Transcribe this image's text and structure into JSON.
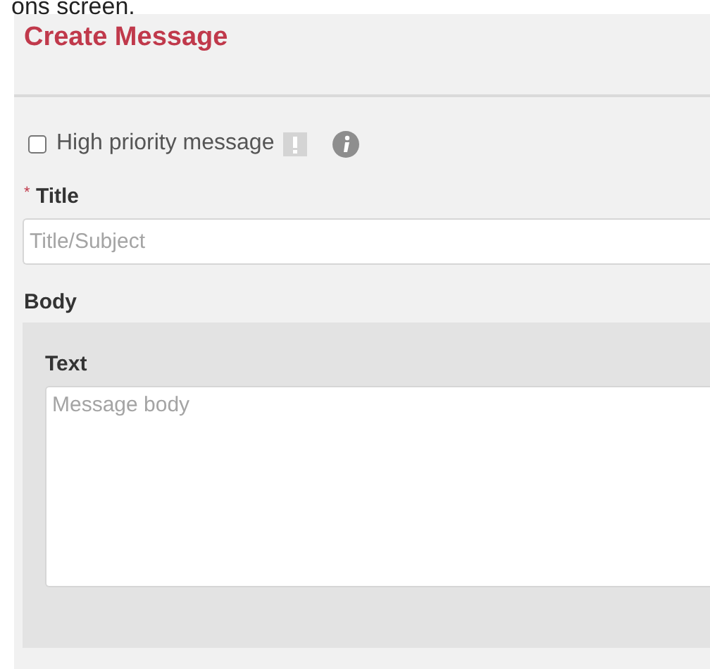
{
  "caption": "ons screen.",
  "title": "Create Message",
  "high_priority": {
    "label": "High priority message",
    "checked": false
  },
  "title_field": {
    "label": "Title",
    "required_mark": "*",
    "placeholder": "Title/Subject"
  },
  "body": {
    "heading": "Body",
    "text_label": "Text",
    "placeholder": "Message body"
  }
}
